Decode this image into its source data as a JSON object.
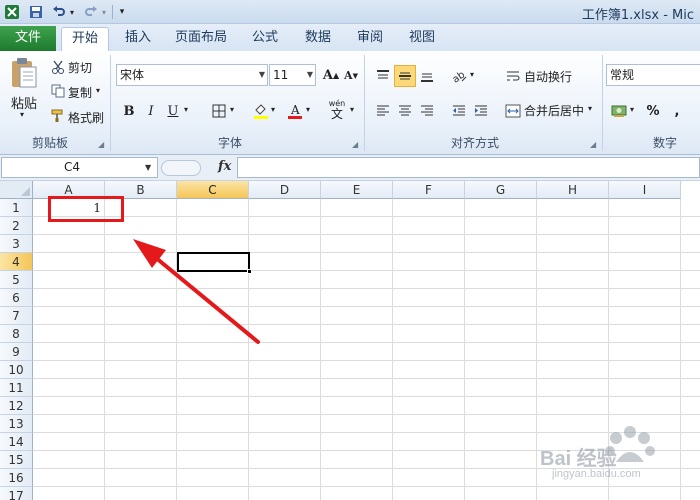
{
  "title_bar": {
    "title": "工作簿1.xlsx - Mic",
    "app_icon": "excel-logo-icon",
    "save_icon": "save-icon",
    "undo_icon": "undo-icon",
    "redo_icon": "redo-icon",
    "customize_icon": "customize-qat-icon"
  },
  "tabs": [
    {
      "label": "文件"
    },
    {
      "label": "开始"
    },
    {
      "label": "插入"
    },
    {
      "label": "页面布局"
    },
    {
      "label": "公式"
    },
    {
      "label": "数据"
    },
    {
      "label": "审阅"
    },
    {
      "label": "视图"
    }
  ],
  "ribbon": {
    "clipboard": {
      "group_label": "剪贴板",
      "paste_label": "粘贴",
      "cut_label": "剪切",
      "copy_label": "复制",
      "format_painter_label": "格式刷"
    },
    "font": {
      "group_label": "字体",
      "font_name": "宋体",
      "font_size": "11",
      "bold": "B",
      "italic": "I",
      "underline": "U",
      "grow_font": "A",
      "shrink_font": "A",
      "phonetic_top": "wén",
      "phonetic_bottom": "文"
    },
    "alignment": {
      "group_label": "对齐方式",
      "wrap_text_label": "自动换行",
      "merge_center_label": "合并后居中"
    },
    "number": {
      "group_label": "数字",
      "format_value": "常规",
      "percent": "%",
      "comma": ","
    }
  },
  "formula_bar": {
    "name_box": "C4",
    "fx_label": "fx",
    "formula": ""
  },
  "sheet": {
    "columns": [
      "A",
      "B",
      "C",
      "D",
      "E",
      "F",
      "G",
      "H",
      "I"
    ],
    "rows": [
      "1",
      "2",
      "3",
      "4",
      "5",
      "6",
      "7",
      "8",
      "9",
      "10",
      "11",
      "12",
      "13",
      "14",
      "15",
      "16",
      "17"
    ],
    "active_cell": "C4",
    "cells": {
      "A1": "1"
    }
  },
  "annotation_color": "#e3191b",
  "accent_color": "#217346",
  "watermark": {
    "brand": "Bai 经验",
    "domain": "jingyan.baidu.com"
  }
}
